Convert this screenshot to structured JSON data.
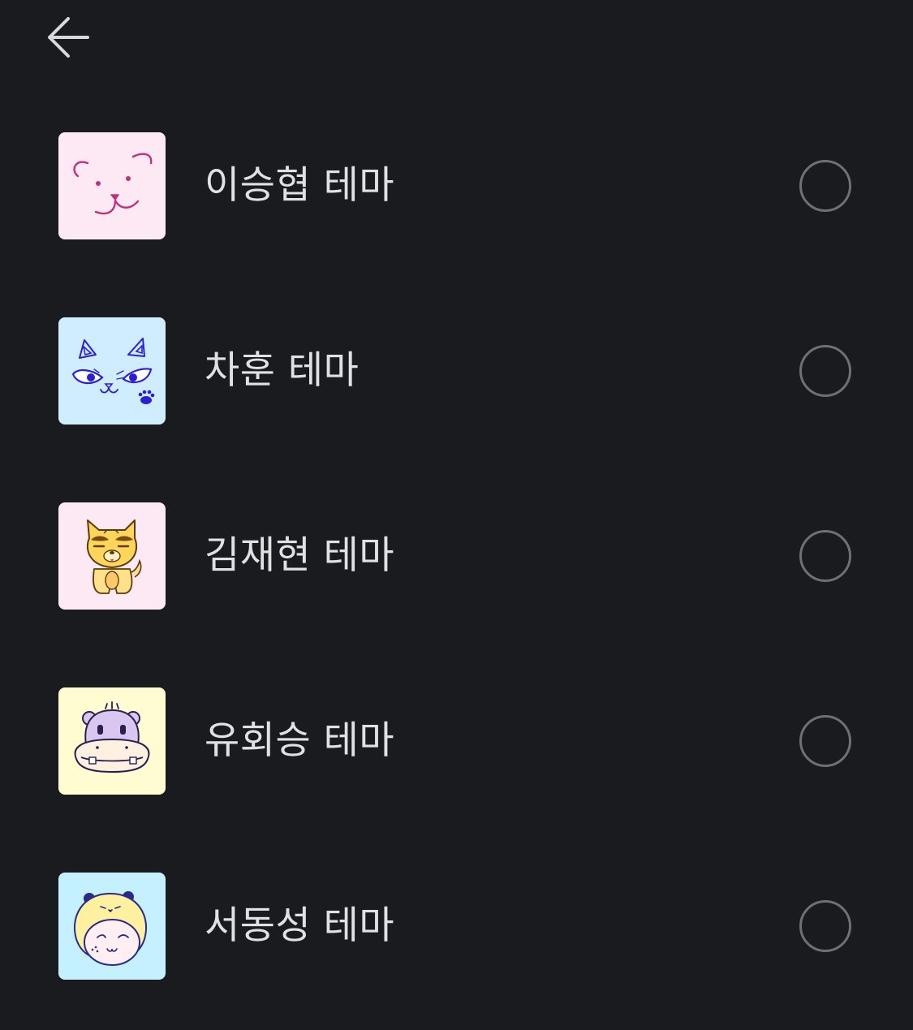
{
  "header": {
    "back_icon": "arrow-left-icon"
  },
  "themes": [
    {
      "label": "이승협 테마",
      "thumb_bg": "#fde9f4",
      "icon": "bear-face-icon",
      "selected": false
    },
    {
      "label": "차훈 테마",
      "thumb_bg": "#d0edff",
      "icon": "cat-face-icon",
      "selected": false
    },
    {
      "label": "김재현 테마",
      "thumb_bg": "#fde9f4",
      "icon": "dog-character-icon",
      "selected": false
    },
    {
      "label": "유회승 테마",
      "thumb_bg": "#fffcd2",
      "icon": "hippo-face-icon",
      "selected": false
    },
    {
      "label": "서동성 테마",
      "thumb_bg": "#c4f0ff",
      "icon": "bear-hood-icon",
      "selected": false
    }
  ],
  "colors": {
    "background": "#1a1b1f",
    "text": "#e1e1e4",
    "radio_border": "#6f6f76"
  }
}
